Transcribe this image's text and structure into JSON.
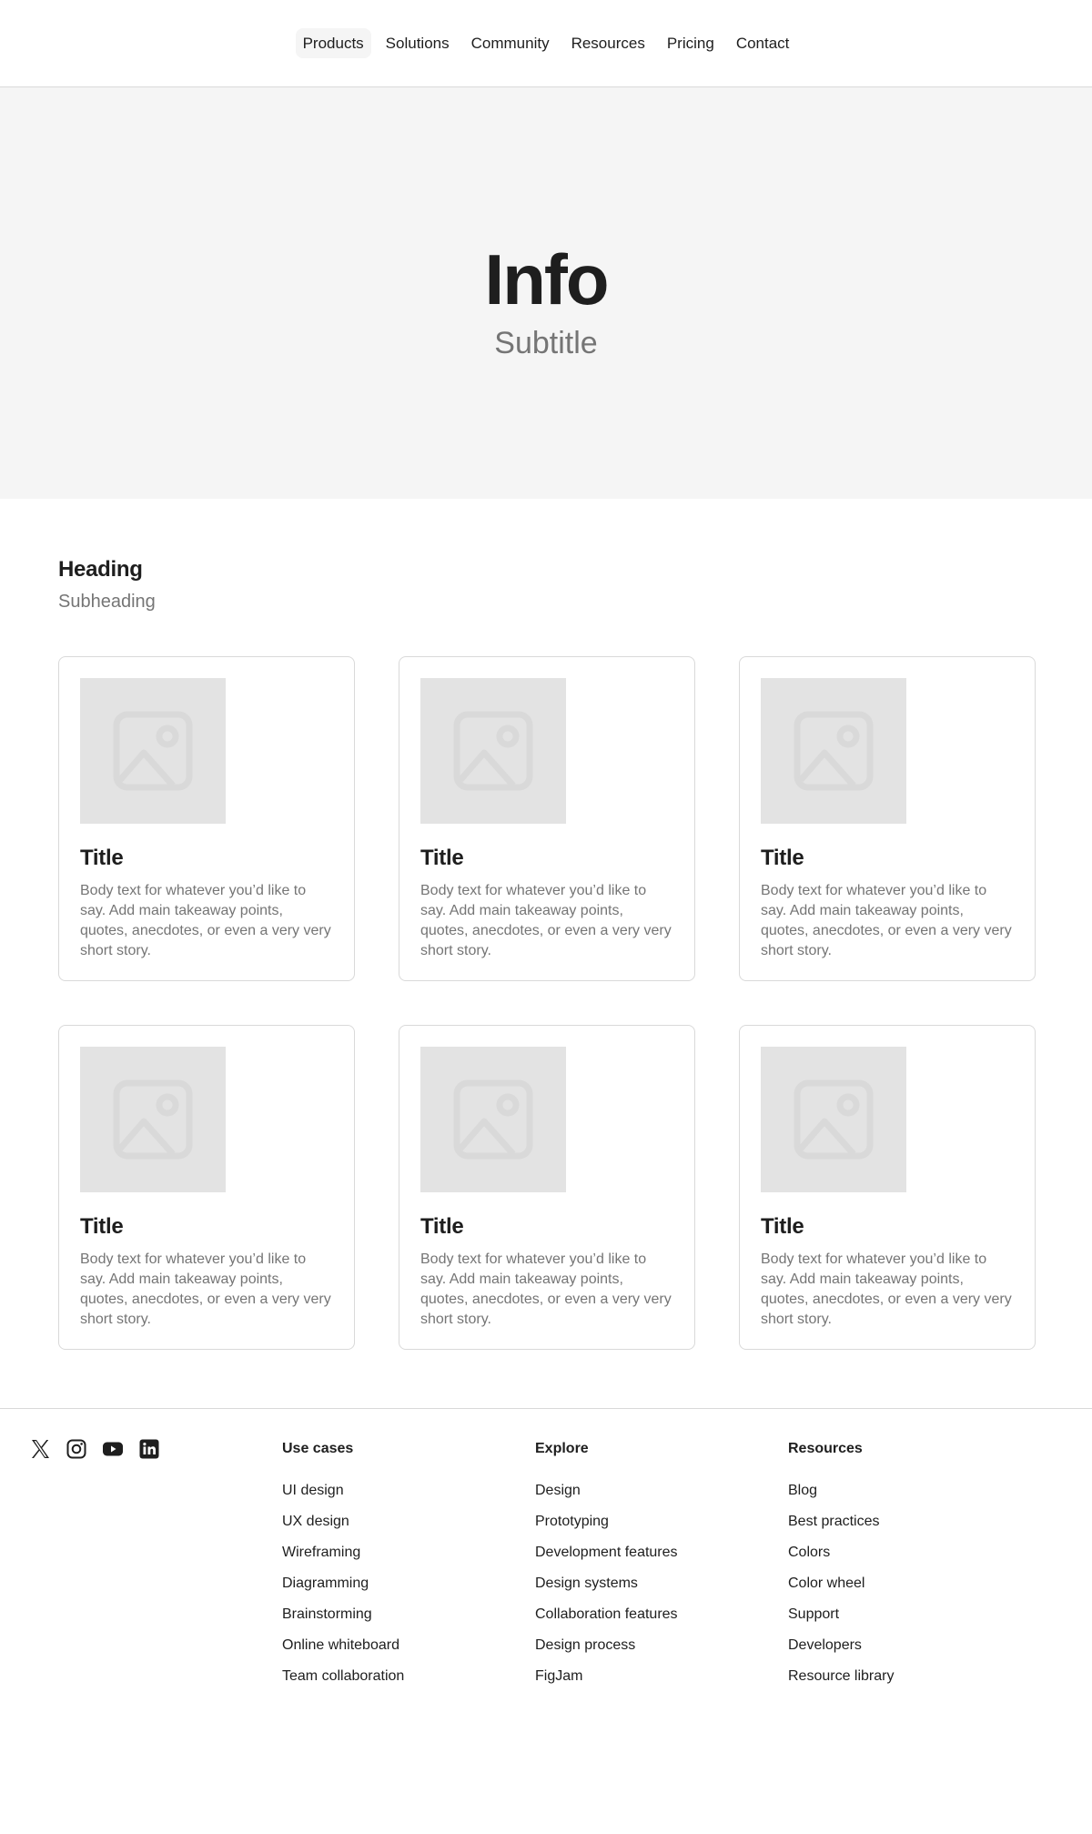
{
  "nav": {
    "items": [
      {
        "label": "Products",
        "active": true
      },
      {
        "label": "Solutions"
      },
      {
        "label": "Community"
      },
      {
        "label": "Resources"
      },
      {
        "label": "Pricing"
      },
      {
        "label": "Contact"
      }
    ]
  },
  "hero": {
    "title": "Info",
    "subtitle": "Subtitle"
  },
  "section": {
    "heading": "Heading",
    "subheading": "Subheading",
    "cards": [
      {
        "title": "Title",
        "body": "Body text for whatever you’d like to say. Add main takeaway points, quotes, anecdotes, or even a very very short story.",
        "image_icon": "image-placeholder-icon"
      },
      {
        "title": "Title",
        "body": "Body text for whatever you’d like to say. Add main takeaway points, quotes, anecdotes, or even a very very short story.",
        "image_icon": "image-placeholder-icon"
      },
      {
        "title": "Title",
        "body": "Body text for whatever you’d like to say. Add main takeaway points, quotes, anecdotes, or even a very very short story.",
        "image_icon": "image-placeholder-icon"
      },
      {
        "title": "Title",
        "body": "Body text for whatever you’d like to say. Add main takeaway points, quotes, anecdotes, or even a very very short story.",
        "image_icon": "image-placeholder-icon"
      },
      {
        "title": "Title",
        "body": "Body text for whatever you’d like to say. Add main takeaway points, quotes, anecdotes, or even a very very short story.",
        "image_icon": "image-placeholder-icon"
      },
      {
        "title": "Title",
        "body": "Body text for whatever you’d like to say. Add main takeaway points, quotes, anecdotes, or even a very very short story.",
        "image_icon": "image-placeholder-icon"
      }
    ]
  },
  "footer": {
    "socials": [
      "x-icon",
      "instagram-icon",
      "youtube-icon",
      "linkedin-icon"
    ],
    "columns": [
      {
        "title": "Use cases",
        "links": [
          "UI design",
          "UX design",
          "Wireframing",
          "Diagramming",
          "Brainstorming",
          "Online whiteboard",
          "Team collaboration"
        ]
      },
      {
        "title": "Explore",
        "links": [
          "Design",
          "Prototyping",
          "Development features",
          "Design systems",
          "Collaboration features",
          "Design process",
          "FigJam"
        ]
      },
      {
        "title": "Resources",
        "links": [
          "Blog",
          "Best practices",
          "Colors",
          "Color wheel",
          "Support",
          "Developers",
          "Resource library"
        ]
      }
    ]
  },
  "colors": {
    "text_primary": "#1e1e1e",
    "text_secondary": "#757575",
    "hero_bg": "#f5f5f5",
    "border": "#d9d9d9",
    "placeholder_bg": "#e3e3e3"
  }
}
